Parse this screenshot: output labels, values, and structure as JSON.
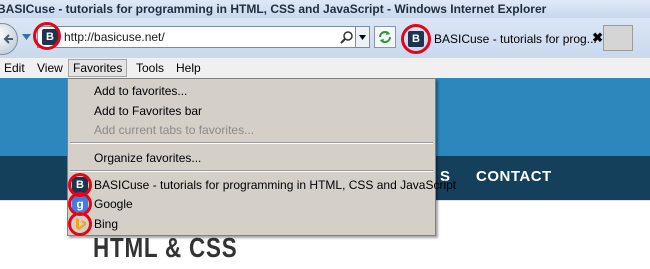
{
  "window": {
    "title": "BASICuse - tutorials for programming in HTML, CSS and JavaScript - Windows Internet Explorer"
  },
  "address_bar": {
    "url": "http://basicuse.net/",
    "favicon_letter": "B"
  },
  "tab": {
    "title": "BASICuse - tutorials for prog...",
    "close": "✖",
    "favicon_letter": "B"
  },
  "menu": {
    "items": [
      "Edit",
      "View",
      "Favorites",
      "Tools",
      "Help"
    ],
    "active": "Favorites"
  },
  "favorites_menu": {
    "add_to_favorites": "Add to favorites...",
    "add_to_favorites_bar": "Add to Favorites bar",
    "add_tabs": "Add current tabs to favorites...",
    "organize": "Organize favorites...",
    "links": [
      {
        "label": "BASICuse - tutorials for programming in HTML, CSS and JavaScript",
        "icon": "B"
      },
      {
        "label": "Google",
        "icon": "g"
      },
      {
        "label": "Bing",
        "icon": "bing"
      }
    ]
  },
  "site": {
    "nav_visible": [
      "S",
      "CONTACT"
    ],
    "heading": "HTML & CSS"
  },
  "colors": {
    "highlight_ring": "#e4051a",
    "site_blue": "#2c87bc",
    "site_navy": "#14405c"
  }
}
